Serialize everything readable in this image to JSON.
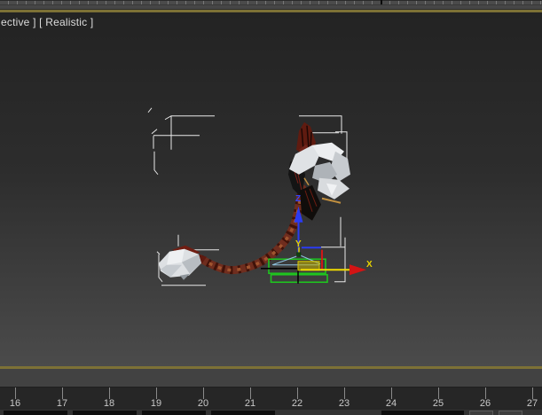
{
  "app": "3ds-max-viewport",
  "viewport": {
    "label_visible": "ective ] [ Realistic ]",
    "shading_mode": "Realistic",
    "gizmo": {
      "x_label": "X",
      "y_label": "Y",
      "z_label": "Z"
    },
    "colors": {
      "background_top": "#232323",
      "background_bottom": "#4b4b4b",
      "active_border": "#7d7136",
      "selection_bracket": "#e9e9e9",
      "x_axis": "#f2dc00",
      "x_arrowhead": "#d31414",
      "y_label": "#e8d400",
      "z_axis": "#2b3bf2",
      "plane_handle": "#c8b400",
      "spline_green": "#1fc41f",
      "rope": "#6f2d1e",
      "crystal": "#dfe2e5"
    }
  },
  "timeline": {
    "frames": [
      "16",
      "17",
      "18",
      "19",
      "20",
      "21",
      "22",
      "23",
      "24",
      "25",
      "26",
      "27"
    ],
    "tick_start_x": 17,
    "tick_spacing": 53
  }
}
